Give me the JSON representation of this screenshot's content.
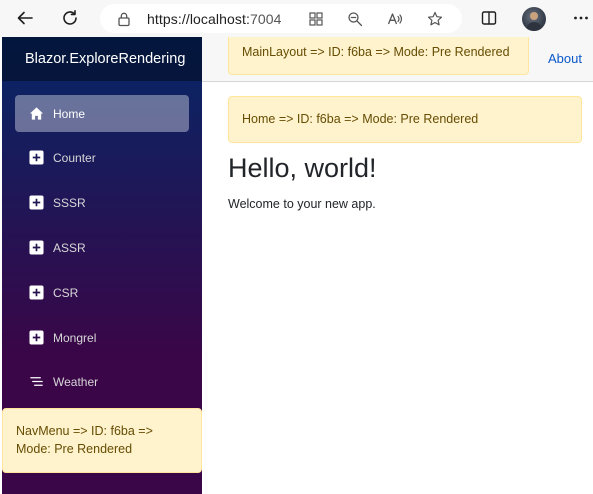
{
  "browser": {
    "url_host": "https://localhost:",
    "url_port": "7004"
  },
  "sidebar": {
    "brand": "Blazor.ExploreRendering",
    "items": [
      {
        "label": "Home",
        "icon": "house-icon",
        "active": true
      },
      {
        "label": "Counter",
        "icon": "plus-square-icon"
      },
      {
        "label": "SSSR",
        "icon": "plus-square-icon"
      },
      {
        "label": "ASSR",
        "icon": "plus-square-icon"
      },
      {
        "label": "CSR",
        "icon": "plus-square-icon"
      },
      {
        "label": "Mongrel",
        "icon": "plus-square-icon"
      },
      {
        "label": "Weather",
        "icon": "list-icon"
      }
    ],
    "note": "NavMenu => ID: f6ba => Mode: Pre Rendered"
  },
  "topbar": {
    "layout_note": "MainLayout => ID: f6ba => Mode: Pre Rendered",
    "about": "About"
  },
  "main": {
    "home_note": "Home => ID: f6ba => Mode: Pre Rendered",
    "title": "Hello, world!",
    "welcome": "Welcome to your new app."
  },
  "colors": {
    "sidebar_top": "#052767",
    "sidebar_bottom": "#3a0647",
    "note_bg": "#fff3cd",
    "note_text": "#664d03",
    "link": "#0a58ca"
  }
}
